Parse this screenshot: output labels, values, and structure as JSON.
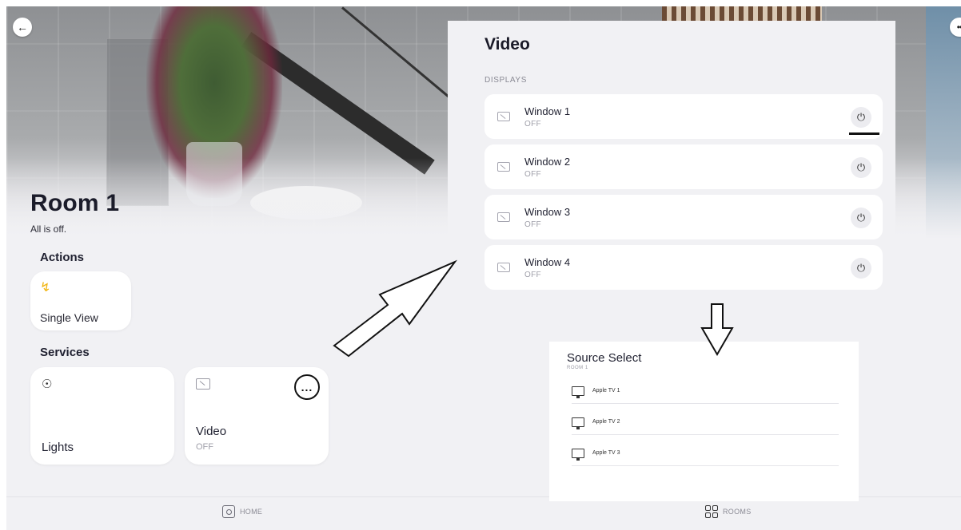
{
  "header": {
    "back_icon": "arrow-left-icon",
    "more_icon": "more-horizontal-icon"
  },
  "room": {
    "title": "Room 1",
    "status": "All is off."
  },
  "actions": {
    "label": "Actions",
    "items": [
      {
        "label": "Single View",
        "icon": "lightning-icon",
        "icon_color": "#f1b40f"
      }
    ]
  },
  "services": {
    "label": "Services",
    "items": [
      {
        "label": "Lights",
        "icon": "lightbulb-icon",
        "status": ""
      },
      {
        "label": "Video",
        "icon": "display-icon",
        "status": "OFF",
        "more_label": "..."
      }
    ]
  },
  "bottom_nav": {
    "items": [
      {
        "label": "HOME",
        "icon": "home-icon"
      },
      {
        "label": "ROOMS",
        "icon": "grid-icon"
      }
    ]
  },
  "video_panel": {
    "title": "Video",
    "section_label": "DISPLAYS",
    "displays": [
      {
        "name": "Window 1",
        "status": "OFF",
        "power_icon": "power-icon"
      },
      {
        "name": "Window 2",
        "status": "OFF",
        "power_icon": "power-icon"
      },
      {
        "name": "Window 3",
        "status": "OFF",
        "power_icon": "power-icon"
      },
      {
        "name": "Window 4",
        "status": "OFF",
        "power_icon": "power-icon"
      }
    ]
  },
  "source_select": {
    "title": "Source Select",
    "room": "ROOM 1",
    "sources": [
      {
        "name": "Apple TV 1",
        "icon": "tv-icon"
      },
      {
        "name": "Apple TV 2",
        "icon": "tv-icon"
      },
      {
        "name": "Apple TV 3",
        "icon": "tv-icon"
      }
    ]
  },
  "colors": {
    "background": "#f1f1f4",
    "card": "#ffffff",
    "accent_yellow": "#f1b40f",
    "muted_text": "#a0a0aa"
  }
}
